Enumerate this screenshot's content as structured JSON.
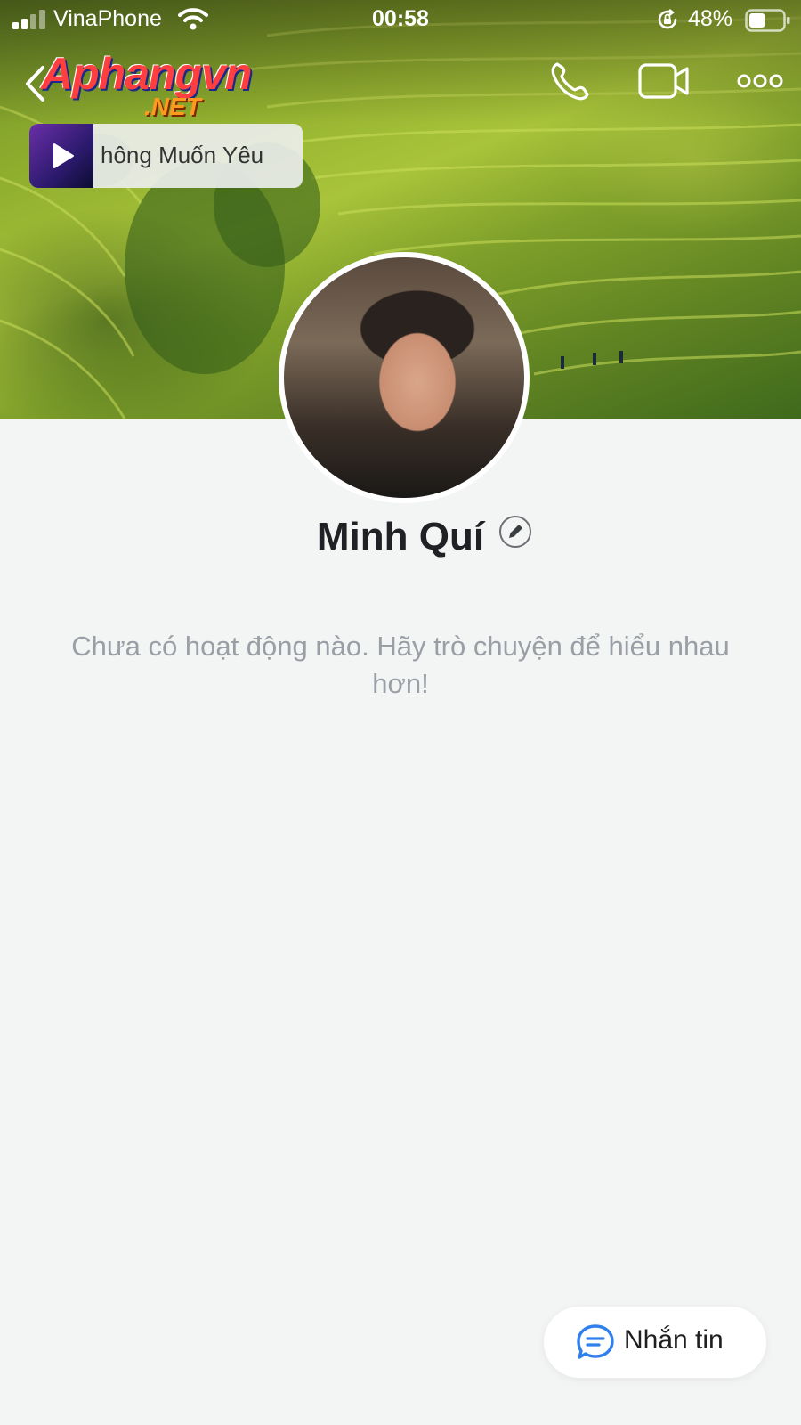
{
  "status_bar": {
    "carrier": "VinaPhone",
    "time": "00:58",
    "battery_percent": "48%",
    "battery_level": 0.48
  },
  "header": {
    "logo_main": "Aphangvn",
    "logo_sub": ".NET",
    "icons": [
      "back-icon",
      "phone-icon",
      "video-camera-icon",
      "more-icon"
    ]
  },
  "music": {
    "song_title": "hông Muốn Yêu"
  },
  "profile": {
    "name": "Minh Quí",
    "empty_message": "Chưa có hoạt động nào. Hãy trò chuyện để hiểu nhau hơn!"
  },
  "actions": {
    "message_label": "Nhắn tin"
  },
  "colors": {
    "background": "#f3f4f4",
    "message_icon": "#2f80ed",
    "muted_text": "#9a9fa5"
  }
}
